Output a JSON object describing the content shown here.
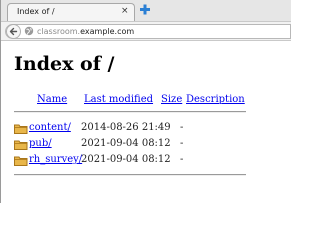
{
  "tab": {
    "title": "Index of /",
    "close_glyph": "×",
    "icons": {
      "close": "close-icon",
      "new_tab": "plus-icon"
    }
  },
  "navbar": {
    "url_host": "classroom.",
    "url_domain": "example.com",
    "icons": {
      "back": "back-arrow-icon",
      "site": "globe-icon"
    }
  },
  "page": {
    "heading": "Index of /",
    "columns": {
      "name": "Name",
      "last_modified": "Last modified",
      "size": "Size",
      "description": "Description"
    },
    "rows": [
      {
        "name": "content/",
        "modified": "2014-08-26 21:49",
        "size": "-",
        "icon": "folder-icon"
      },
      {
        "name": "pub/",
        "modified": "2021-09-04 08:12",
        "size": "-",
        "icon": "folder-icon"
      },
      {
        "name": "rh_survey/",
        "modified": "2021-09-04 08:12",
        "size": "-",
        "icon": "folder-icon"
      }
    ]
  },
  "colors": {
    "link": "#0000ee",
    "folder": "#d9a033",
    "new_tab_plus": "#2a7fd4"
  }
}
